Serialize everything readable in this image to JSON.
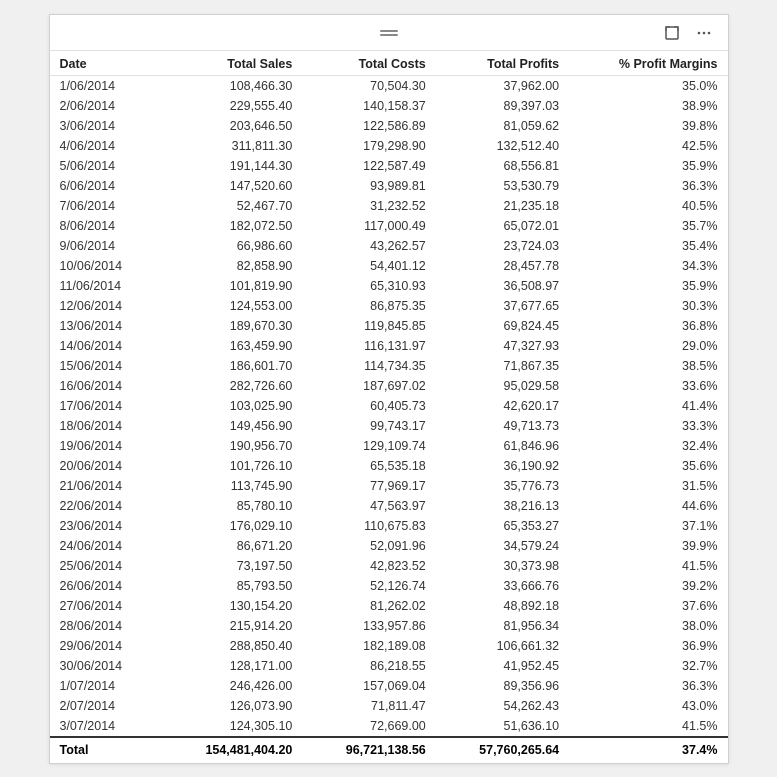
{
  "toolbar": {
    "drag_icon": "≡",
    "expand_icon": "⤢",
    "more_icon": "···"
  },
  "table": {
    "headers": [
      "Date",
      "Total Sales",
      "Total Costs",
      "Total Profits",
      "% Profit Margins"
    ],
    "rows": [
      [
        "1/06/2014",
        "108,466.30",
        "70,504.30",
        "37,962.00",
        "35.0%"
      ],
      [
        "2/06/2014",
        "229,555.40",
        "140,158.37",
        "89,397.03",
        "38.9%"
      ],
      [
        "3/06/2014",
        "203,646.50",
        "122,586.89",
        "81,059.62",
        "39.8%"
      ],
      [
        "4/06/2014",
        "311,811.30",
        "179,298.90",
        "132,512.40",
        "42.5%"
      ],
      [
        "5/06/2014",
        "191,144.30",
        "122,587.49",
        "68,556.81",
        "35.9%"
      ],
      [
        "6/06/2014",
        "147,520.60",
        "93,989.81",
        "53,530.79",
        "36.3%"
      ],
      [
        "7/06/2014",
        "52,467.70",
        "31,232.52",
        "21,235.18",
        "40.5%"
      ],
      [
        "8/06/2014",
        "182,072.50",
        "117,000.49",
        "65,072.01",
        "35.7%"
      ],
      [
        "9/06/2014",
        "66,986.60",
        "43,262.57",
        "23,724.03",
        "35.4%"
      ],
      [
        "10/06/2014",
        "82,858.90",
        "54,401.12",
        "28,457.78",
        "34.3%"
      ],
      [
        "11/06/2014",
        "101,819.90",
        "65,310.93",
        "36,508.97",
        "35.9%"
      ],
      [
        "12/06/2014",
        "124,553.00",
        "86,875.35",
        "37,677.65",
        "30.3%"
      ],
      [
        "13/06/2014",
        "189,670.30",
        "119,845.85",
        "69,824.45",
        "36.8%"
      ],
      [
        "14/06/2014",
        "163,459.90",
        "116,131.97",
        "47,327.93",
        "29.0%"
      ],
      [
        "15/06/2014",
        "186,601.70",
        "114,734.35",
        "71,867.35",
        "38.5%"
      ],
      [
        "16/06/2014",
        "282,726.60",
        "187,697.02",
        "95,029.58",
        "33.6%"
      ],
      [
        "17/06/2014",
        "103,025.90",
        "60,405.73",
        "42,620.17",
        "41.4%"
      ],
      [
        "18/06/2014",
        "149,456.90",
        "99,743.17",
        "49,713.73",
        "33.3%"
      ],
      [
        "19/06/2014",
        "190,956.70",
        "129,109.74",
        "61,846.96",
        "32.4%"
      ],
      [
        "20/06/2014",
        "101,726.10",
        "65,535.18",
        "36,190.92",
        "35.6%"
      ],
      [
        "21/06/2014",
        "113,745.90",
        "77,969.17",
        "35,776.73",
        "31.5%"
      ],
      [
        "22/06/2014",
        "85,780.10",
        "47,563.97",
        "38,216.13",
        "44.6%"
      ],
      [
        "23/06/2014",
        "176,029.10",
        "110,675.83",
        "65,353.27",
        "37.1%"
      ],
      [
        "24/06/2014",
        "86,671.20",
        "52,091.96",
        "34,579.24",
        "39.9%"
      ],
      [
        "25/06/2014",
        "73,197.50",
        "42,823.52",
        "30,373.98",
        "41.5%"
      ],
      [
        "26/06/2014",
        "85,793.50",
        "52,126.74",
        "33,666.76",
        "39.2%"
      ],
      [
        "27/06/2014",
        "130,154.20",
        "81,262.02",
        "48,892.18",
        "37.6%"
      ],
      [
        "28/06/2014",
        "215,914.20",
        "133,957.86",
        "81,956.34",
        "38.0%"
      ],
      [
        "29/06/2014",
        "288,850.40",
        "182,189.08",
        "106,661.32",
        "36.9%"
      ],
      [
        "30/06/2014",
        "128,171.00",
        "86,218.55",
        "41,952.45",
        "32.7%"
      ],
      [
        "1/07/2014",
        "246,426.00",
        "157,069.04",
        "89,356.96",
        "36.3%"
      ],
      [
        "2/07/2014",
        "126,073.90",
        "71,811.47",
        "54,262.43",
        "43.0%"
      ],
      [
        "3/07/2014",
        "124,305.10",
        "72,669.00",
        "51,636.10",
        "41.5%"
      ]
    ],
    "footer": [
      "Total",
      "154,481,404.20",
      "96,721,138.56",
      "57,760,265.64",
      "37.4%"
    ]
  }
}
